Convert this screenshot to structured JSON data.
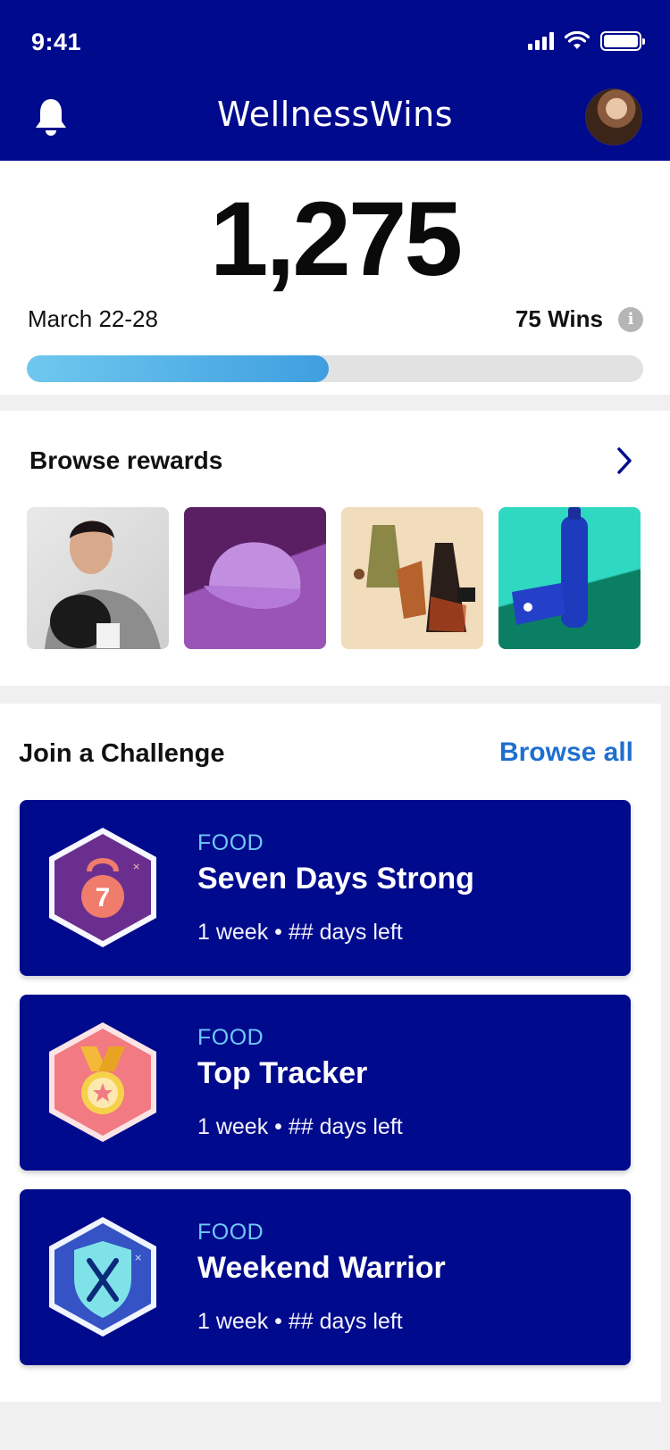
{
  "status_bar": {
    "time": "9:41"
  },
  "header": {
    "title": "WellnessWins"
  },
  "points": {
    "value": "1,275",
    "date_range": "March 22-28",
    "wins": "75 Wins",
    "progress_fraction": 0.49
  },
  "rewards": {
    "title": "Browse rewards",
    "tiles": [
      "boxing-hoodie-photo",
      "purple-cap-photo",
      "clothing-flatlay-photo",
      "water-bottle-photo"
    ]
  },
  "challenges": {
    "title": "Join a Challenge",
    "browse_all": "Browse all",
    "items": [
      {
        "category": "FOOD",
        "name": "Seven Days Strong",
        "meta": "1 week • ## days left",
        "badge": "kettlebell-badge-icon"
      },
      {
        "category": "FOOD",
        "name": "Top Tracker",
        "meta": "1 week • ## days left",
        "badge": "medal-badge-icon"
      },
      {
        "category": "FOOD",
        "name": "Weekend Warrior",
        "meta": "1 week • ## days left",
        "badge": "shield-utensils-badge-icon"
      }
    ]
  },
  "colors": {
    "header_bg": "#000a8c",
    "accent_link": "#1f6fd0",
    "category": "#6fc7f7",
    "progress": "#4aa8e4"
  }
}
